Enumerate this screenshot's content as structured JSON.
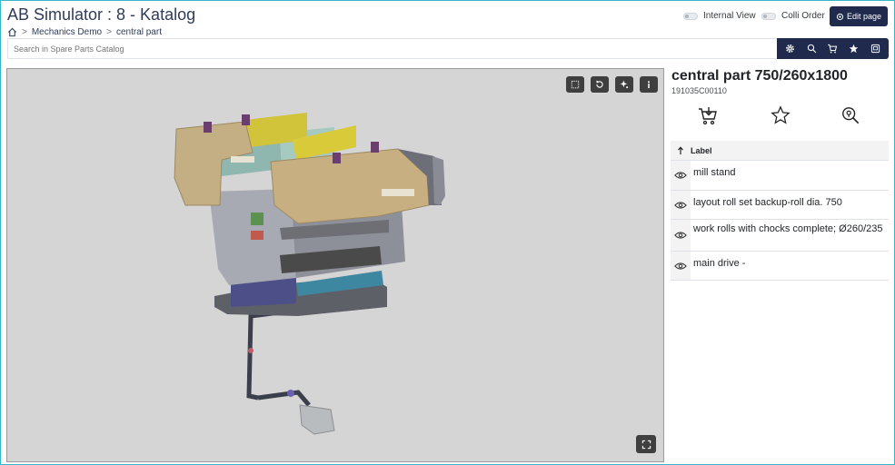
{
  "header": {
    "title": "AB Simulator : 8 - Katalog",
    "breadcrumb": [
      "Mechanics Demo",
      "central part"
    ],
    "internal_view_label": "Internal View",
    "colli_order_label": "Colli Order",
    "edit_page_label": "Edit page"
  },
  "search": {
    "placeholder": "Search in Spare Parts Catalog"
  },
  "toolbar": {
    "icons": [
      "gear-icon",
      "search-icon",
      "cart-icon",
      "star-icon",
      "catalog-icon"
    ]
  },
  "viewer": {
    "buttons": [
      "fit-icon",
      "reset-icon",
      "explode-icon",
      "info-icon",
      "fullscreen-icon"
    ]
  },
  "part": {
    "title": "central part 750/260x1800",
    "number": "191035C00110"
  },
  "bom": {
    "label_header": "Label",
    "rows": [
      {
        "label": "mill stand"
      },
      {
        "label": "layout roll set backup-roll dia. 750"
      },
      {
        "label": "work rolls with chocks complete; Ø260/235"
      },
      {
        "label": "main drive -"
      }
    ]
  },
  "colors": {
    "navy": "#1f2a4d",
    "frame": "#35b6c9",
    "viewer_bg": "#d5d5d5"
  }
}
